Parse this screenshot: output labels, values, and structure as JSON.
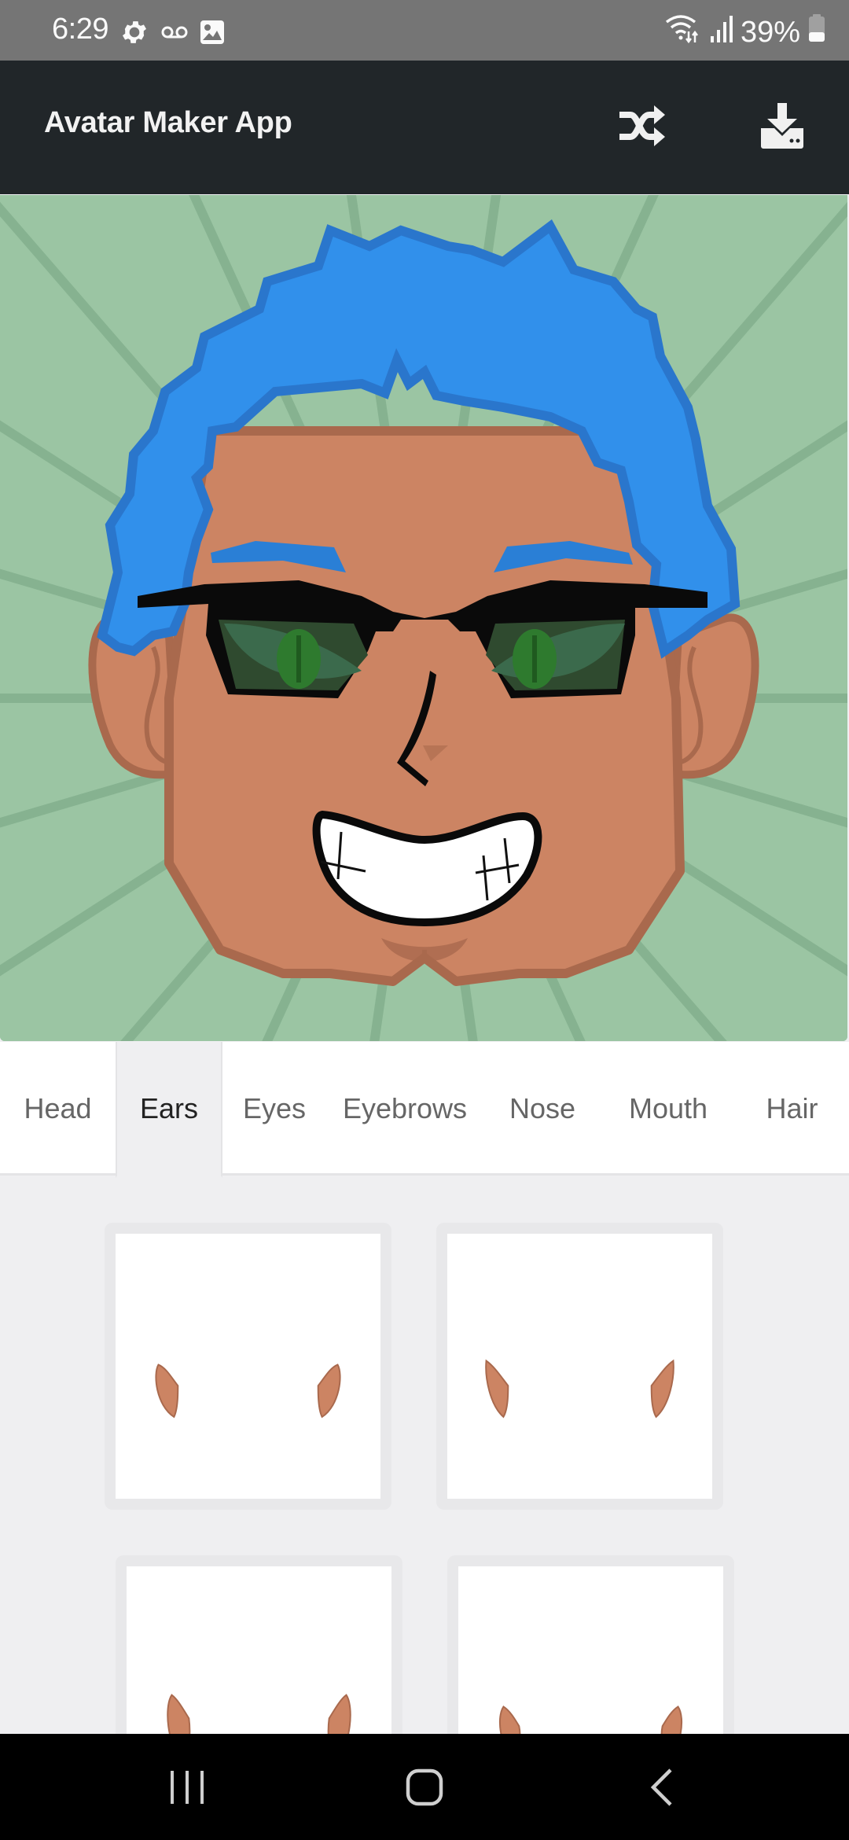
{
  "status_bar": {
    "time": "6:29",
    "left_icons": [
      "settings-gear-icon",
      "voicemail-icon",
      "gallery-icon"
    ],
    "right_icons": [
      "wifi-data-icon",
      "signal-bars-icon"
    ],
    "battery_percent": "39%",
    "battery_level": 0.39
  },
  "app_bar": {
    "title": "Avatar Maker App",
    "actions": [
      {
        "name": "shuffle",
        "icon": "shuffle-icon"
      },
      {
        "name": "download",
        "icon": "download-icon"
      }
    ]
  },
  "avatar": {
    "background_color": "#9bc5a3",
    "ray_color": "#86b290",
    "skin_color": "#cc8463",
    "skin_outline": "#a9694d",
    "hair_color": "#3190eb",
    "hair_outline": "#2a76cc",
    "glasses_frame": "#0a0a0a",
    "lens_color": "#2f4a2f",
    "iris_color": "#2e7a2e",
    "parts": {
      "head": "square-jaw",
      "ears": "round",
      "eyes": "cat-eye",
      "eyebrows": "thick-flat",
      "nose": "angled-line",
      "mouth": "toothy-grin",
      "hair": "spiky",
      "accessory": "sunglasses"
    }
  },
  "tabs": {
    "active": "Ears",
    "items": [
      {
        "label": "Head"
      },
      {
        "label": "Ears"
      },
      {
        "label": "Eyes"
      },
      {
        "label": "Eyebrows"
      },
      {
        "label": "Nose"
      },
      {
        "label": "Mouth"
      },
      {
        "label": "Hair"
      }
    ]
  },
  "ear_options": [
    {
      "style": "pointed-small"
    },
    {
      "style": "pointed-tall"
    },
    {
      "style": "elf-long"
    },
    {
      "style": "elf-short"
    }
  ],
  "nav_bar": {
    "buttons": [
      {
        "name": "recent-apps",
        "icon": "recent-apps-icon"
      },
      {
        "name": "home",
        "icon": "home-icon"
      },
      {
        "name": "back",
        "icon": "back-icon"
      }
    ]
  }
}
